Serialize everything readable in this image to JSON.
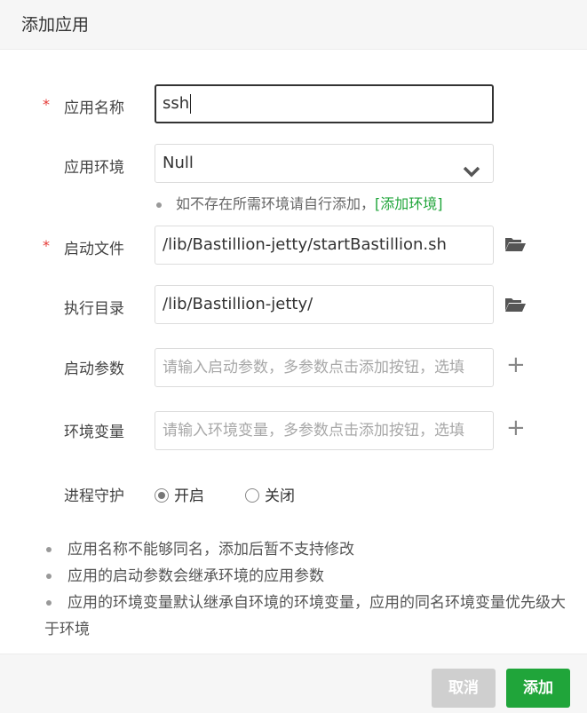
{
  "dialog": {
    "title": "添加应用"
  },
  "form": {
    "name": {
      "label": "应用名称",
      "required_mark": "*",
      "value": "ssh"
    },
    "env": {
      "label": "应用环境",
      "value": "Null",
      "hint": "如不存在所需环境请自行添加，",
      "hint_link": "[添加环境]"
    },
    "start_file": {
      "label": "启动文件",
      "required_mark": "*",
      "value": "/lib/Bastillion-jetty/startBastillion.sh"
    },
    "work_dir": {
      "label": "执行目录",
      "value": "/lib/Bastillion-jetty/"
    },
    "start_args": {
      "label": "启动参数",
      "placeholder": "请输入启动参数，多参数点击添加按钮，选填"
    },
    "env_vars": {
      "label": "环境变量",
      "placeholder": "请输入环境变量，多参数点击添加按钮，选填"
    },
    "daemon": {
      "label": "进程守护",
      "options": [
        "开启",
        "关闭"
      ],
      "selected": "开启"
    }
  },
  "notes": [
    "应用名称不能够同名，添加后暂不支持修改",
    "应用的启动参数会继承环境的应用参数",
    "应用的环境变量默认继承自环境的环境变量，应用的同名环境变量优先级大于环境"
  ],
  "footer": {
    "cancel_label": "取消",
    "add_label": "添加"
  },
  "colors": {
    "accent": "#20a53a",
    "required": "#e53935",
    "disabled": "#cfcfcf"
  },
  "icons": {
    "folder": "folder-open-icon",
    "plus": "plus-icon",
    "chevron": "chevron-down-icon"
  }
}
